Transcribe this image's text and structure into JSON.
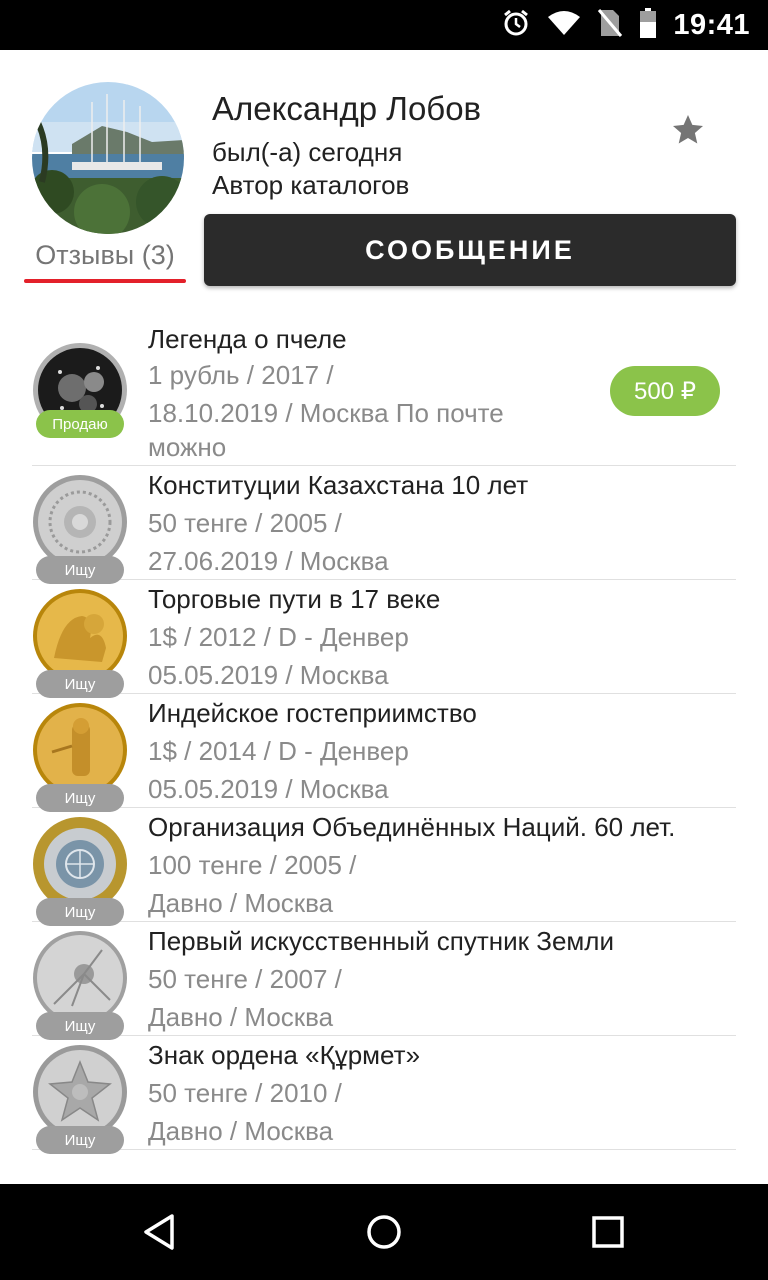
{
  "status_bar": {
    "time": "19:41",
    "icons": [
      "alarm-icon",
      "wifi-icon",
      "no-sim-icon",
      "battery-icon"
    ]
  },
  "profile": {
    "name": "Александр Лобов",
    "status": "был(-а) сегодня",
    "role": "Автор каталогов",
    "reviews_label": "Отзывы (3)",
    "message_button": "СООБЩЕНИЕ",
    "favorite_icon": "star-icon"
  },
  "colors": {
    "accent_red": "#e3202a",
    "sell_green": "#8bc34a",
    "seek_gray": "#9e9e9e",
    "button_dark": "#2b2b2b"
  },
  "coins": [
    {
      "title": "Легенда о пчеле",
      "line1": "1 рубль / 2017 /",
      "line2": "18.10.2019 / Москва  По почте",
      "line3": "можно",
      "badge": "Продаю",
      "price": "500 ₽"
    },
    {
      "title": "Конституции Казахстана 10 лет",
      "line1": "50 тенге / 2005 /",
      "line2": "27.06.2019 / Москва",
      "badge": "Ищу"
    },
    {
      "title": "Торговые пути в 17 веке",
      "line1": "1$ / 2012 / D - Денвер",
      "line2": "05.05.2019 / Москва",
      "badge": "Ищу"
    },
    {
      "title": "Индейское гостеприимство",
      "line1": "1$ / 2014 / D - Денвер",
      "line2": "05.05.2019 / Москва",
      "badge": "Ищу"
    },
    {
      "title": "Организация Объединённых Наций. 60 лет.",
      "line1": "100 тенге / 2005 /",
      "line2": "Давно / Москва",
      "badge": "Ищу"
    },
    {
      "title": "Первый искусственный спутник Земли",
      "line1": "50 тенге / 2007 /",
      "line2": "Давно / Москва",
      "badge": "Ищу"
    },
    {
      "title": "Знак ордена «Құрмет»",
      "line1": "50 тенге / 2010 /",
      "line2": "Давно / Москва",
      "badge": "Ищу"
    }
  ],
  "nav_bar": {
    "icons": [
      "back-icon",
      "home-icon",
      "recents-icon"
    ]
  }
}
